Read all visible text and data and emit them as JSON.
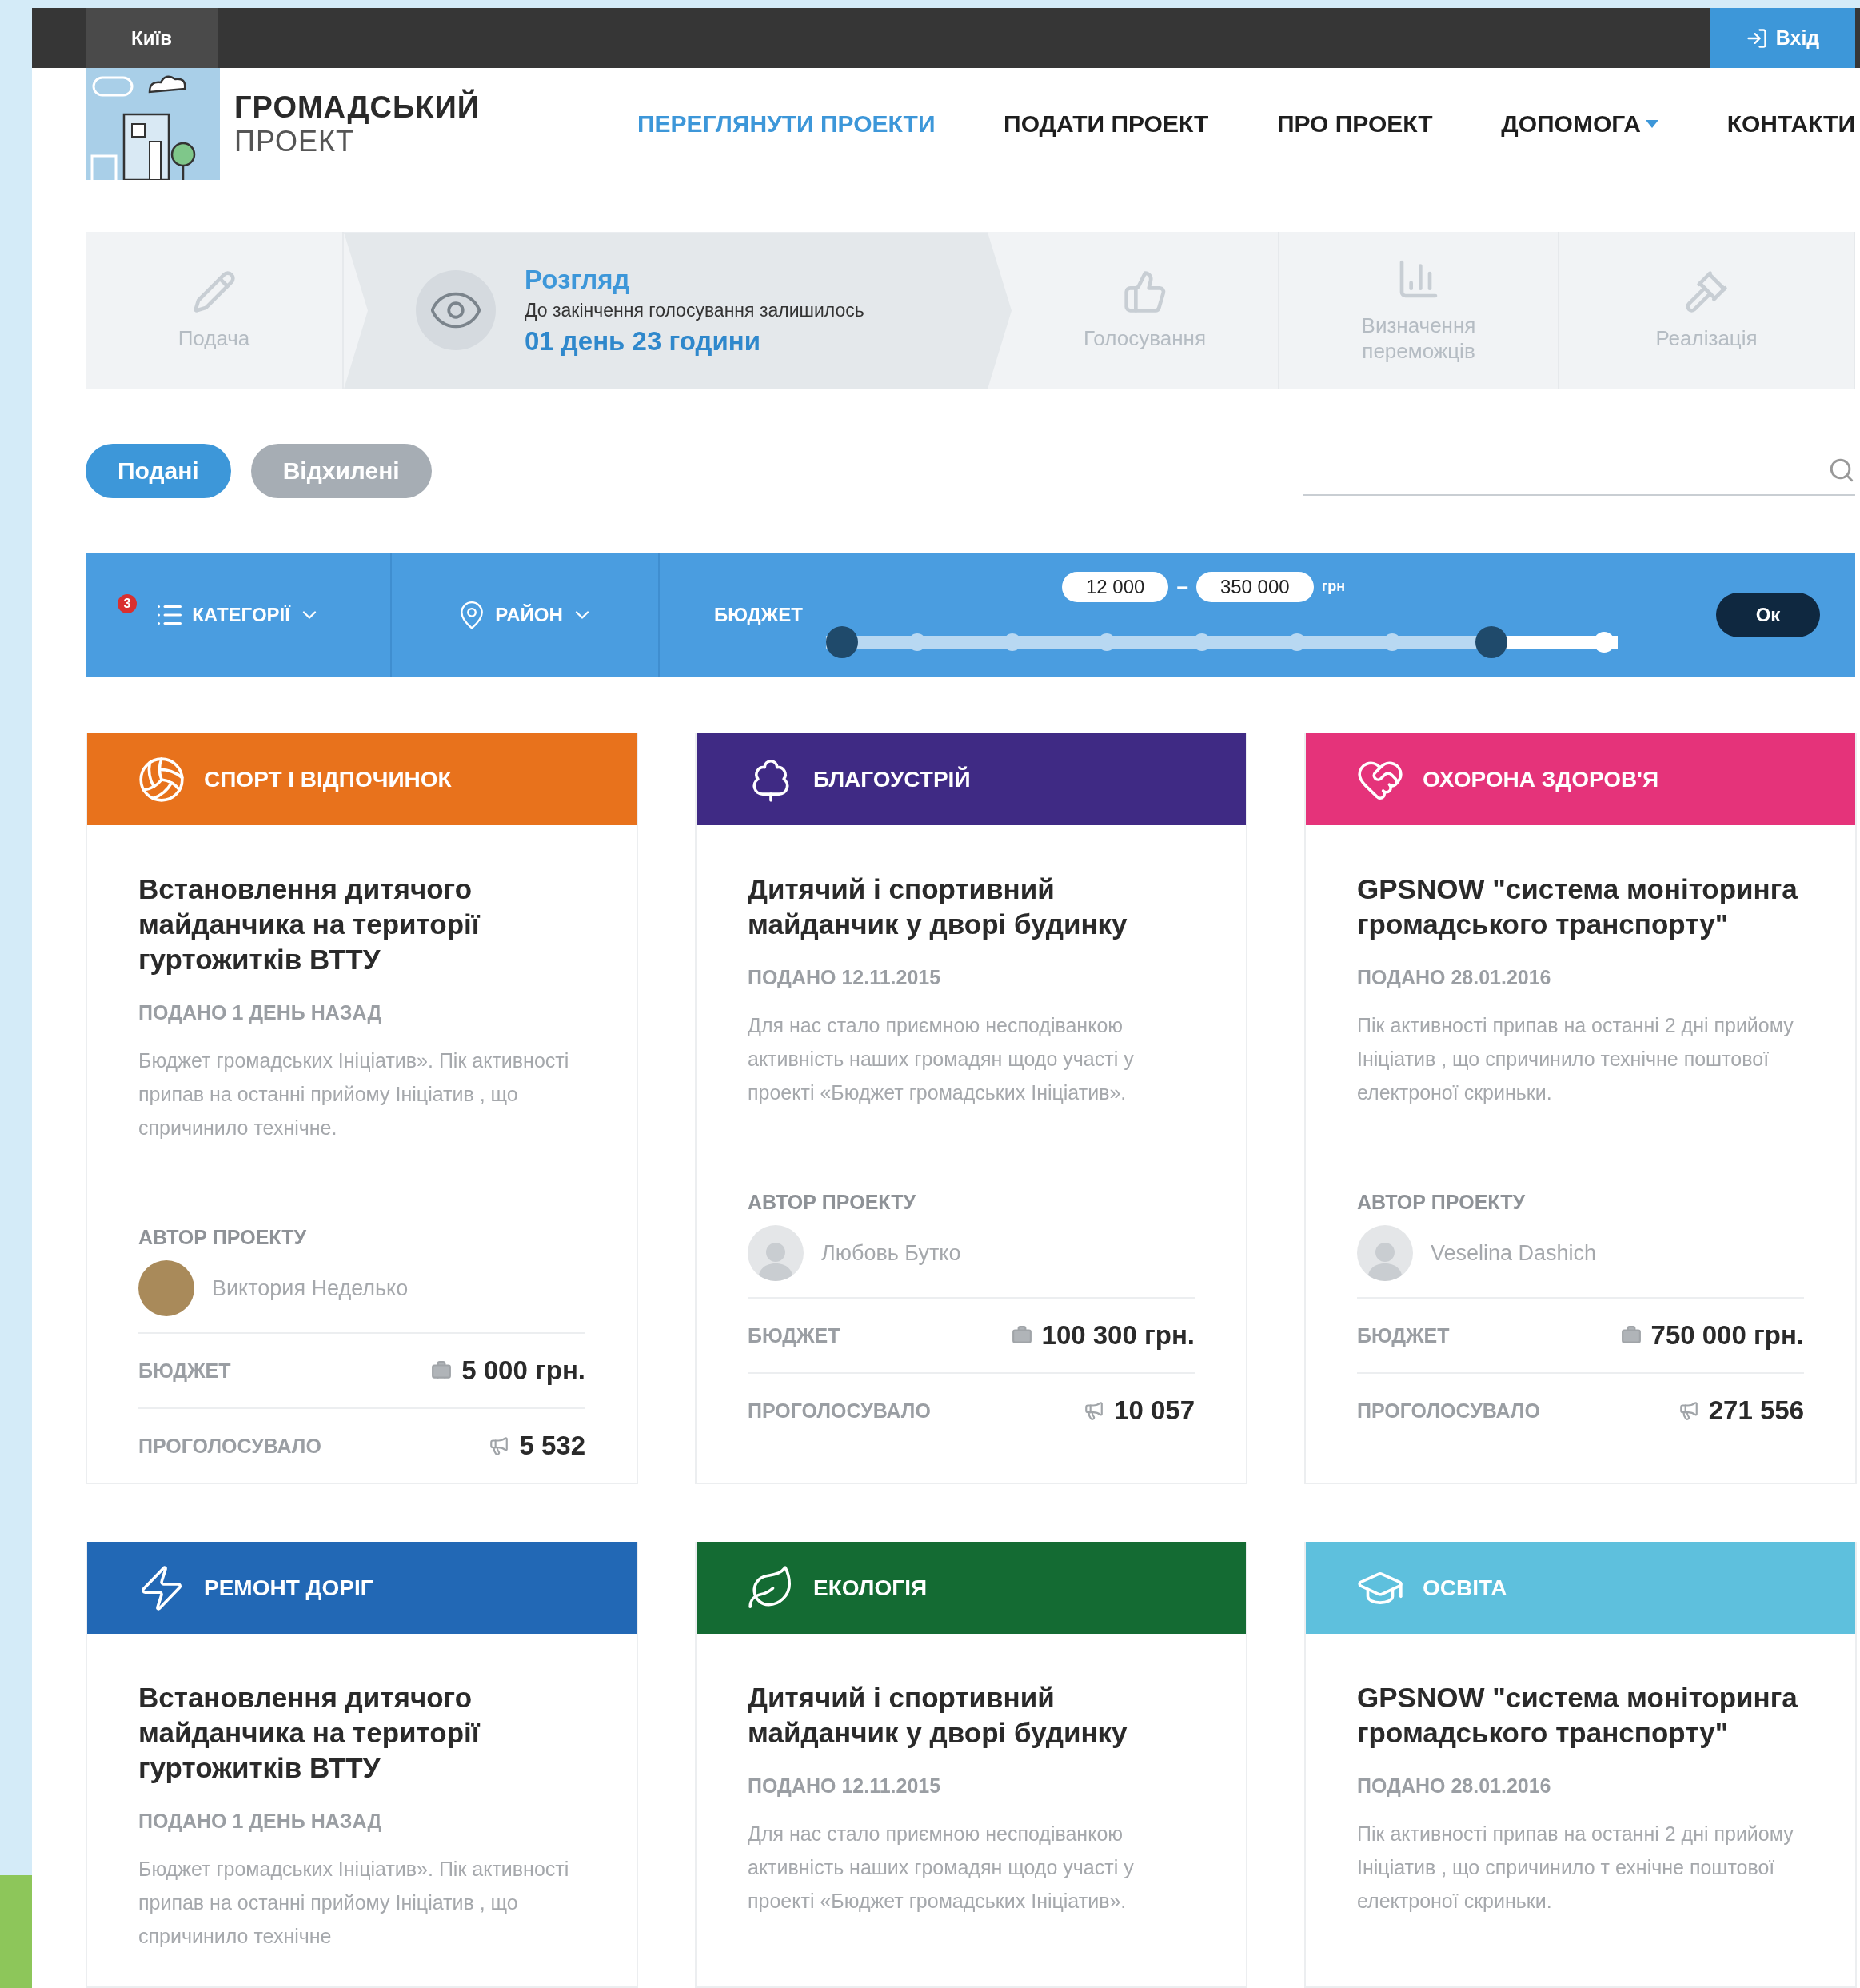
{
  "top_bar": {
    "city": "Київ",
    "login": "Вхід"
  },
  "logo": {
    "line1": "ГРОМАДСЬКИЙ",
    "line2": "ПРОЕКТ"
  },
  "nav": [
    {
      "label": "ПЕРЕГЛЯНУТИ ПРОЕКТИ",
      "selected": true,
      "kind": "link"
    },
    {
      "label": "ПОДАТИ ПРОЕКТ",
      "selected": false,
      "kind": "link"
    },
    {
      "label": "ПРО ПРОЕКТ",
      "selected": false,
      "kind": "link"
    },
    {
      "label": "ДОПОМОГА",
      "selected": false,
      "kind": "dropdown"
    },
    {
      "label": "КОНТАКТИ",
      "selected": false,
      "kind": "link"
    }
  ],
  "stages": [
    {
      "label": "Подача",
      "selected": false,
      "kind": "submit"
    },
    {
      "label": "Розгляд",
      "selected": true,
      "kind": "review",
      "note": "До закінчення голосування залишилось",
      "countdown": "01 день 23 години"
    },
    {
      "label": "Голосування",
      "selected": false,
      "kind": "vote"
    },
    {
      "label": "Визначення переможців",
      "selected": false,
      "kind": "winners"
    },
    {
      "label": "Реалізація",
      "selected": false,
      "kind": "implement"
    }
  ],
  "tabs": [
    {
      "label": "Подані",
      "selected": true
    },
    {
      "label": "Відхилені",
      "selected": false
    }
  ],
  "filters": {
    "categories": {
      "label": "КАТЕГОРІЇ",
      "badge": "3"
    },
    "district": {
      "label": "РАЙОН"
    },
    "budget": {
      "label": "БЮДЖЕТ",
      "from": "12 000",
      "separator": "–",
      "to": "350 000",
      "unit": "грн",
      "level": 0.84
    },
    "ok": "Ок"
  },
  "cards": [
    {
      "kind": "sport",
      "category": "СПОРТ І ВІДПОЧИНОК",
      "color": "#e8721c",
      "title": "Встановлення дитячого майданчика на території гуртожитків ВТТУ",
      "date": "ПОДАНО 1 ДЕНЬ НАЗАД",
      "description": "Бюджет громадських Ініціатив». Пік активності припав на останні прийому Ініціатив , що спричинило технічне.",
      "author_label": "АВТОР ПРОЕКТУ",
      "author": {
        "name": "Виктория Неделько",
        "photo": true
      },
      "budget_label": "БЮДЖЕТ",
      "budget": "5 000 грн.",
      "votes_label": "ПРОГОЛОСУВАЛО",
      "votes": "5 532"
    },
    {
      "kind": "landscaping",
      "category": "БЛАГОУСТРІЙ",
      "color": "#3f2a84",
      "title": "Дитячий і спортивний майданчик у дворі будинку",
      "date": "ПОДАНО 12.11.2015",
      "description": "Для нас стало приємною несподіванкою активність наших громадян щодо участі у проекті  «Бюджет громадських Ініціатив».",
      "author_label": "АВТОР ПРОЕКТУ",
      "author": {
        "name": "Любовь Бутко",
        "photo": false
      },
      "budget_label": "БЮДЖЕТ",
      "budget": "100 300 грн.",
      "votes_label": "ПРОГОЛОСУВАЛО",
      "votes": "10 057"
    },
    {
      "kind": "health",
      "category": "ОХОРОНА ЗДОРОВ'Я",
      "color": "#e5337a",
      "title": "GPSNOW \"система моніторинга громадського транспорту\"",
      "date": "ПОДАНО 28.01.2016",
      "description": "Пік активності припав на останні 2 дні прийому Ініціатив , що спричинило технічне поштової електроної скриньки.",
      "author_label": "АВТОР ПРОЕКТУ",
      "author": {
        "name": "Veselina Dashich",
        "photo": false
      },
      "budget_label": "БЮДЖЕТ",
      "budget": "750 000 грн.",
      "votes_label": "ПРОГОЛОСУВАЛО",
      "votes": "271 556"
    },
    {
      "kind": "roads",
      "category": "РЕМОНТ ДОРІГ",
      "color": "#2268b5",
      "title": "Встановлення дитячого майданчика на території гуртожитків ВТТУ",
      "date": "ПОДАНО 1 ДЕНЬ НАЗАД",
      "description": "Бюджет громадських Ініціатив». Пік активності припав на останні прийому Ініціатив , що спричинило технічне"
    },
    {
      "kind": "ecology",
      "category": "ЕКОЛОГІЯ",
      "color": "#146b33",
      "title": "Дитячий і спортивний майданчик у дворі будинку",
      "date": "ПОДАНО 12.11.2015",
      "description": "Для нас стало приємною несподіванкою активність наших громадян щодо участі у проекті  «Бюджет громадських Ініціатив»."
    },
    {
      "kind": "education",
      "category": "ОСВІТА",
      "color": "#5ec0dd",
      "title": "GPSNOW \"система моніторинга громадського транспорту\"",
      "date": "ПОДАНО 28.01.2016",
      "description": "Пік активності припав на останні 2 дні прийому Ініціатив , що спричинило т ехнічне поштової електроної скриньки."
    }
  ]
}
